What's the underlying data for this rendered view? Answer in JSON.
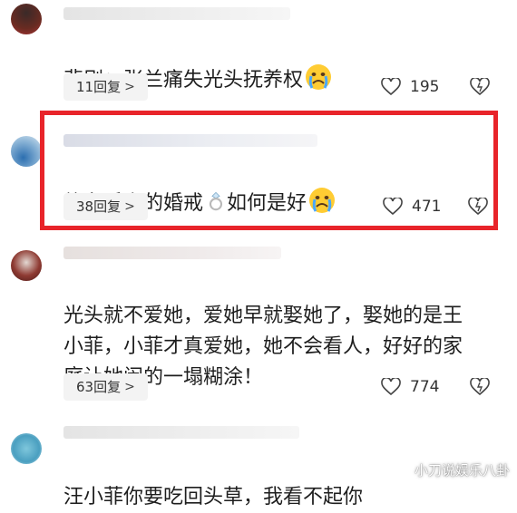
{
  "comments": [
    {
      "text": "悲剧：张兰痛失光头抚养权",
      "reply_label": "11回复",
      "likes": "195",
      "emoji": "crying-face"
    },
    {
      "text": "纹在手上的婚戒",
      "text2": "如何是好",
      "reply_label": "38回复",
      "likes": "471",
      "emoji": "crying-face"
    },
    {
      "text": "光头就不爱她，爱她早就娶她了，娶她的是王\n小菲，小菲才真爱她，她不会看人，好好的家\n庭让她闹的一塌糊涂！",
      "reply_label": "63回复",
      "likes": "774"
    },
    {
      "text": "汪小菲你要吃回头草，我看不起你"
    }
  ],
  "watermark": "小刀说娱乐八卦",
  "colors": {
    "highlight": "#e8242a",
    "pill_bg": "#f3f3f3"
  }
}
